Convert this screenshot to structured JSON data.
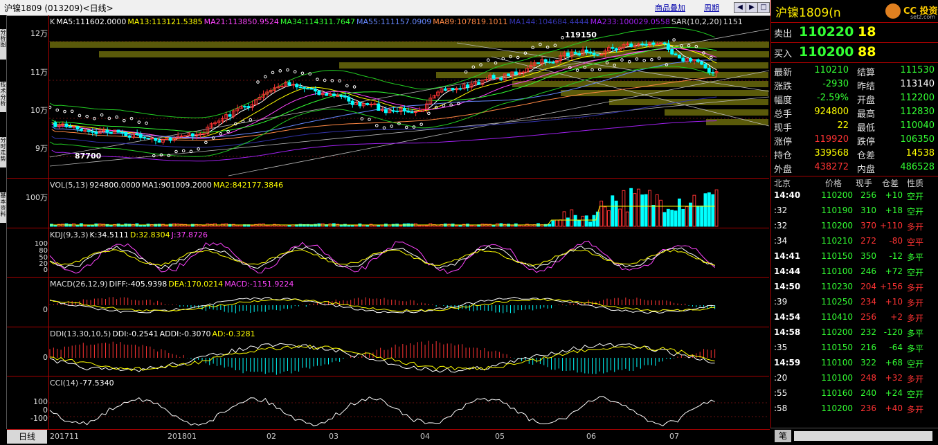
{
  "window": {
    "title": "沪镍1809 (013209)<日线>",
    "toolbar": {
      "overlay": "商品叠加",
      "cycle": "周期"
    },
    "left_tabs": [
      "分析图",
      "技术分析",
      "分时走势",
      "基本资料"
    ]
  },
  "main_chart": {
    "legend": [
      {
        "text": "K",
        "color": "#e0e0e0"
      },
      {
        "text": "MA5:111602.0000",
        "color": "#ffffff"
      },
      {
        "text": "MA13:113121.5385",
        "color": "#ffff00"
      },
      {
        "text": "MA21:113850.9524",
        "color": "#ff44ff"
      },
      {
        "text": "MA34:114311.7647",
        "color": "#33ff33"
      },
      {
        "text": "MA55:111157.0909",
        "color": "#6688ff"
      },
      {
        "text": "MA89:107819.1011",
        "color": "#ff8844"
      },
      {
        "text": "MA144:104684.4444",
        "color": "#3333aa"
      },
      {
        "text": "MA233:100029.0558",
        "color": "#a020f0"
      },
      {
        "text": "SAR(10,2,20)",
        "color": "#e0e0e0"
      },
      {
        "text": "1151",
        "color": "#e0e0e0"
      }
    ],
    "y_labels": [
      "12万",
      "11万",
      "10万",
      "9万"
    ],
    "y_values": [
      120000,
      110000,
      100000,
      90000
    ],
    "high_label": "119150",
    "low_label": "87700"
  },
  "volume": {
    "legend": [
      {
        "text": "VOL(5,13)",
        "color": "#e0e0e0"
      },
      {
        "text": "924800.0000",
        "color": "#ffffff"
      },
      {
        "text": "MA1:901009.2000",
        "color": "#ffffff"
      },
      {
        "text": "MA2:842177.3846",
        "color": "#ffff00"
      }
    ],
    "y_labels": [
      "100万"
    ]
  },
  "kdj": {
    "legend": [
      {
        "text": "KDJ(9,3,3)",
        "color": "#e0e0e0"
      },
      {
        "text": "K:34.5111",
        "color": "#ffffff"
      },
      {
        "text": "D:32.8304",
        "color": "#ffff00"
      },
      {
        "text": "J:37.8726",
        "color": "#ff44ff"
      }
    ],
    "y_labels": [
      "100",
      "80",
      "50",
      "20",
      "0"
    ]
  },
  "macd": {
    "legend": [
      {
        "text": "MACD(26,12,9)",
        "color": "#e0e0e0"
      },
      {
        "text": "DIFF:-405.9398",
        "color": "#ffffff"
      },
      {
        "text": "DEA:170.0214",
        "color": "#ffff00"
      },
      {
        "text": "MACD:-1151.9224",
        "color": "#ff44ff"
      }
    ],
    "y_labels": [
      "0"
    ]
  },
  "ddi": {
    "legend": [
      {
        "text": "DDI(13,30,10,5)",
        "color": "#e0e0e0"
      },
      {
        "text": "DDI:-0.2541",
        "color": "#ffffff"
      },
      {
        "text": "ADDI:-0.3070",
        "color": "#ffffff"
      },
      {
        "text": "AD:-0.3281",
        "color": "#ffff00"
      }
    ],
    "y_labels": [
      "0"
    ]
  },
  "cci": {
    "legend": [
      {
        "text": "CCI(14)",
        "color": "#e0e0e0"
      },
      {
        "text": "-77.5340",
        "color": "#ffffff"
      }
    ],
    "y_labels": [
      "100",
      "0",
      "-100"
    ]
  },
  "x_axis": {
    "period": "日线",
    "ticks": [
      "201711",
      "201801",
      "02",
      "03",
      "04",
      "05",
      "06",
      "07"
    ]
  },
  "quote": {
    "symbol": "沪镍1809",
    "symbol_suffix": "(n",
    "logo_text": "CC 投资",
    "logo_sub": "setz.com",
    "sell_label": "卖出",
    "sell_price": "110220",
    "sell_vol": "18",
    "buy_label": "买入",
    "buy_price": "110200",
    "buy_vol": "88",
    "stats": [
      {
        "l1": "最新",
        "v1": "110210",
        "c1": "green",
        "l2": "结算",
        "v2": "111530",
        "c2": "green"
      },
      {
        "l1": "涨跌",
        "v1": "-2930",
        "c1": "green",
        "l2": "昨结",
        "v2": "113140",
        "c2": "white"
      },
      {
        "l1": "幅度",
        "v1": "-2.59%",
        "c1": "green",
        "l2": "开盘",
        "v2": "112200",
        "c2": "green"
      },
      {
        "l1": "总手",
        "v1": "924800",
        "c1": "yellow",
        "l2": "最高",
        "v2": "112830",
        "c2": "green"
      },
      {
        "l1": "现手",
        "v1": "22",
        "c1": "yellow",
        "l2": "最低",
        "v2": "110040",
        "c2": "green"
      },
      {
        "l1": "涨停",
        "v1": "119920",
        "c1": "red",
        "l2": "跌停",
        "v2": "106350",
        "c2": "green"
      },
      {
        "l1": "持仓",
        "v1": "339568",
        "c1": "yellow",
        "l2": "仓差",
        "v2": "14538",
        "c2": "yellow"
      },
      {
        "l1": "外盘",
        "v1": "438272",
        "c1": "red",
        "l2": "内盘",
        "v2": "486528",
        "c2": "green"
      }
    ],
    "trade_headers": [
      "北京",
      "价格",
      "现手",
      "仓差",
      "性质"
    ],
    "trades": [
      {
        "time": "14:40",
        "price": "110200",
        "vol": "256",
        "vc": "green",
        "oi": "+10",
        "oc": "green",
        "type": "空开",
        "tc": "green"
      },
      {
        "time": ":32",
        "price": "110190",
        "vol": "310",
        "vc": "green",
        "oi": "+18",
        "oc": "green",
        "type": "空开",
        "tc": "green"
      },
      {
        "time": ":32",
        "price": "110200",
        "vol": "370",
        "vc": "red",
        "oi": "+110",
        "oc": "red",
        "type": "多开",
        "tc": "red"
      },
      {
        "time": ":34",
        "price": "110210",
        "vol": "272",
        "vc": "red",
        "oi": "-80",
        "oc": "red",
        "type": "空平",
        "tc": "red"
      },
      {
        "time": "14:41",
        "price": "110150",
        "vol": "350",
        "vc": "green",
        "oi": "-12",
        "oc": "green",
        "type": "多平",
        "tc": "green"
      },
      {
        "time": "14:44",
        "price": "110100",
        "vol": "246",
        "vc": "green",
        "oi": "+72",
        "oc": "green",
        "type": "空开",
        "tc": "green"
      },
      {
        "time": "14:50",
        "price": "110230",
        "vol": "204",
        "vc": "red",
        "oi": "+156",
        "oc": "red",
        "type": "多开",
        "tc": "red"
      },
      {
        "time": ":39",
        "price": "110250",
        "vol": "234",
        "vc": "red",
        "oi": "+10",
        "oc": "red",
        "type": "多开",
        "tc": "red"
      },
      {
        "time": "14:54",
        "price": "110410",
        "vol": "256",
        "vc": "red",
        "oi": "+2",
        "oc": "red",
        "type": "多开",
        "tc": "red"
      },
      {
        "time": "14:58",
        "price": "110200",
        "vol": "232",
        "vc": "green",
        "oi": "-120",
        "oc": "green",
        "type": "多平",
        "tc": "green"
      },
      {
        "time": ":35",
        "price": "110150",
        "vol": "216",
        "vc": "green",
        "oi": "-64",
        "oc": "green",
        "type": "多平",
        "tc": "green"
      },
      {
        "time": "14:59",
        "price": "110100",
        "vol": "322",
        "vc": "green",
        "oi": "+68",
        "oc": "green",
        "type": "空开",
        "tc": "green"
      },
      {
        "time": ":20",
        "price": "110100",
        "vol": "248",
        "vc": "red",
        "oi": "+32",
        "oc": "red",
        "type": "多开",
        "tc": "red"
      },
      {
        "time": ":55",
        "price": "110160",
        "vol": "240",
        "vc": "green",
        "oi": "+24",
        "oc": "green",
        "type": "空开",
        "tc": "green"
      },
      {
        "time": ":58",
        "price": "110200",
        "vol": "236",
        "vc": "red",
        "oi": "+40",
        "oc": "red",
        "type": "多开",
        "tc": "red"
      }
    ],
    "bottom_tab": "笔"
  }
}
